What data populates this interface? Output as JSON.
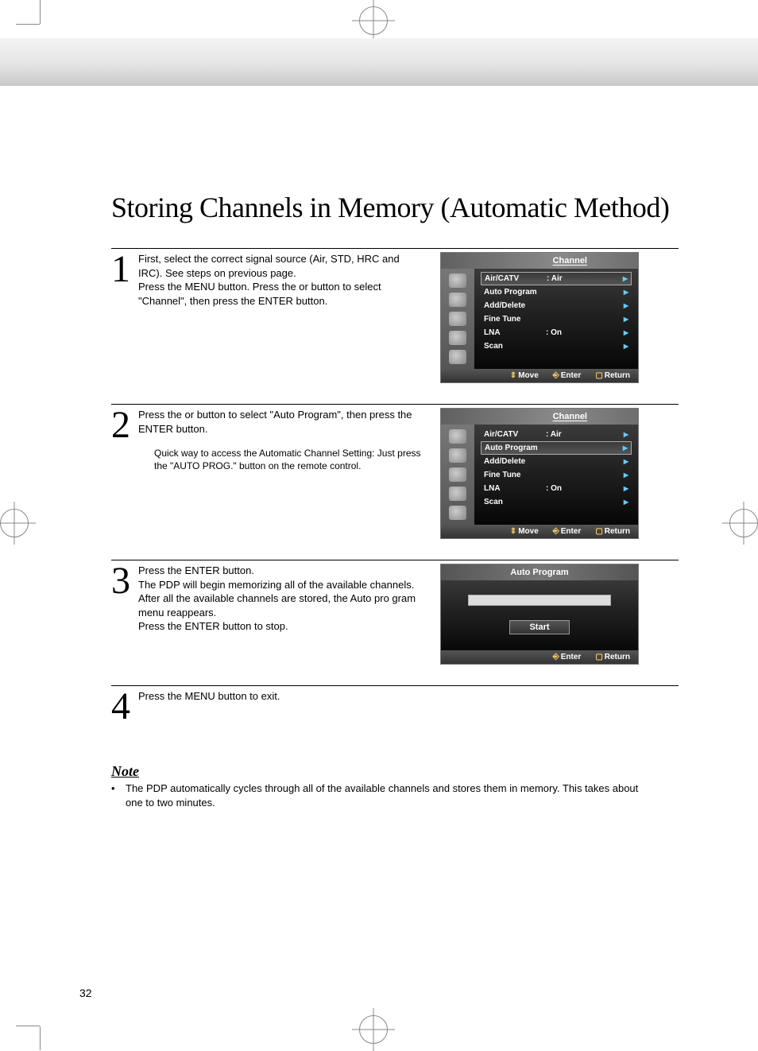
{
  "page_number": "32",
  "title": "Storing Channels in Memory (Automatic Method)",
  "steps": [
    {
      "num": "1",
      "text": "First, select the correct signal source (Air, STD, HRC and IRC). See steps on previous page.\nPress the MENU button. Press the     or     button to select \"Channel\", then press the ENTER button."
    },
    {
      "num": "2",
      "text": "Press the     or     button to select \"Auto Program\", then press the ENTER button.",
      "tip": "Quick way to access the Automatic Channel Setting: Just press the \"AUTO PROG.\" button on the remote control."
    },
    {
      "num": "3",
      "text": "Press the ENTER button.\nThe PDP will begin memorizing all of the available channels.\nAfter all the available channels are stored, the Auto pro gram menu reappears.\nPress the ENTER button to stop."
    },
    {
      "num": "4",
      "text": "Press the MENU button to exit."
    }
  ],
  "osd": {
    "channel_title": "Channel",
    "items": [
      {
        "label": "Air/CATV",
        "value": ":  Air"
      },
      {
        "label": "Auto Program",
        "value": ""
      },
      {
        "label": "Add/Delete",
        "value": ""
      },
      {
        "label": "Fine Tune",
        "value": ""
      },
      {
        "label": "LNA",
        "value": ":  On"
      },
      {
        "label": "Scan",
        "value": ""
      }
    ],
    "footer": {
      "move": "Move",
      "enter": "Enter",
      "return": "Return"
    },
    "auto_program": {
      "title": "Auto Program",
      "button": "Start"
    }
  },
  "note": {
    "heading": "Note",
    "text": "The PDP automatically cycles through all of the available channels and stores them in memory. This takes about one to two minutes."
  }
}
